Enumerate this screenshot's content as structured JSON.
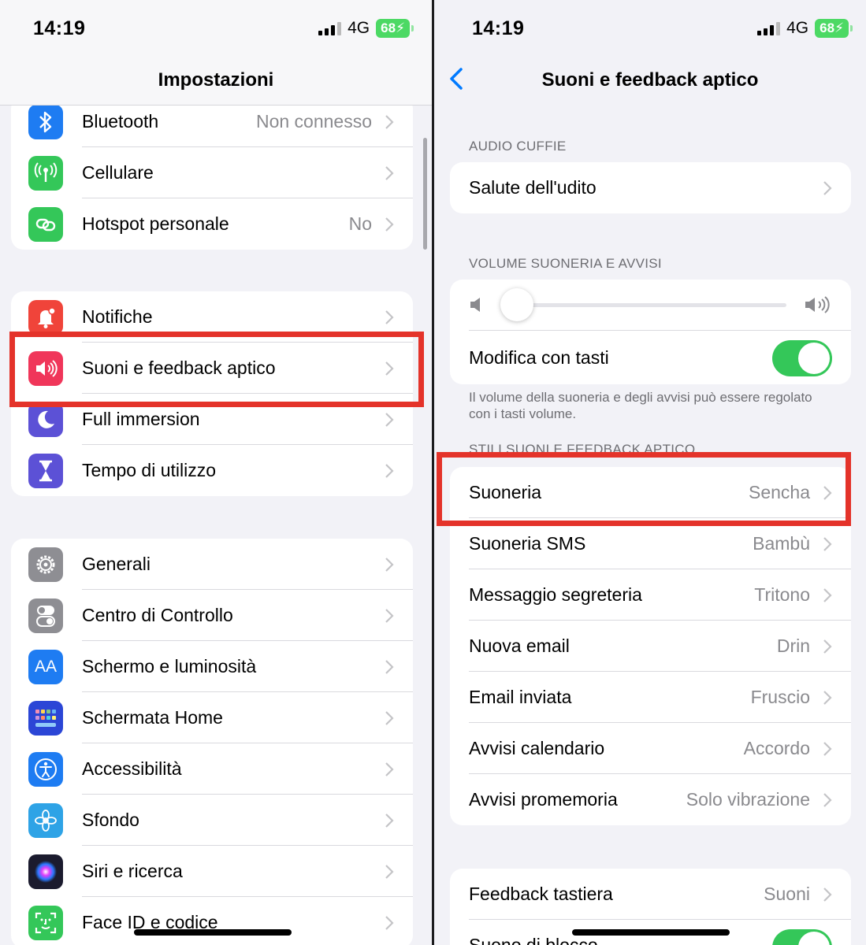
{
  "colors": {
    "highlight_box": "#e4332a",
    "ios_blue": "#007aff",
    "toggle_on": "#34c759",
    "battery_green": "#4cd964"
  },
  "left_screen": {
    "status": {
      "time": "14:19",
      "network": "4G",
      "battery": "68"
    },
    "title": "Impostazioni",
    "groups": [
      {
        "items": [
          {
            "label": "Bluetooth",
            "value": "Non connesso",
            "icon": "bluetooth-icon",
            "color": "#1e7cf2"
          },
          {
            "label": "Cellulare",
            "value": "",
            "icon": "antenna-icon",
            "color": "#34c759"
          },
          {
            "label": "Hotspot personale",
            "value": "No",
            "icon": "hotspot-icon",
            "color": "#34c759"
          }
        ]
      },
      {
        "items": [
          {
            "label": "Notifiche",
            "value": "",
            "icon": "bell-icon",
            "color": "#f0443a"
          },
          {
            "label": "Suoni e feedback aptico",
            "value": "",
            "icon": "speaker-icon",
            "color": "#f0365a"
          },
          {
            "label": "Full immersion",
            "value": "",
            "icon": "moon-icon",
            "color": "#5c51d6"
          },
          {
            "label": "Tempo di utilizzo",
            "value": "",
            "icon": "hourglass-icon",
            "color": "#5c51d6"
          }
        ]
      },
      {
        "items": [
          {
            "label": "Generali",
            "value": "",
            "icon": "gear-icon",
            "color": "#8e8e93"
          },
          {
            "label": "Centro di Controllo",
            "value": "",
            "icon": "switches-icon",
            "color": "#8e8e93"
          },
          {
            "label": "Schermo e luminosità",
            "value": "",
            "icon": "text-size-icon",
            "color": "#1e7cf2"
          },
          {
            "label": "Schermata Home",
            "value": "",
            "icon": "home-grid-icon",
            "color": "#2b46d6"
          },
          {
            "label": "Accessibilità",
            "value": "",
            "icon": "accessibility-icon",
            "color": "#1e7cf2"
          },
          {
            "label": "Sfondo",
            "value": "",
            "icon": "flower-icon",
            "color": "#2ea3e6"
          },
          {
            "label": "Siri e ricerca",
            "value": "",
            "icon": "siri-icon",
            "color": "#1b1b2e"
          },
          {
            "label": "Face ID e codice",
            "value": "",
            "icon": "face-id-icon",
            "color": "#34c759"
          }
        ]
      }
    ],
    "icon_text": {
      "text_size": "AA"
    }
  },
  "right_screen": {
    "status": {
      "time": "14:19",
      "network": "4G",
      "battery": "68"
    },
    "title": "Suoni e feedback aptico",
    "audio_section": {
      "header": "AUDIO CUFFIE",
      "items": [
        {
          "label": "Salute dell'udito"
        }
      ]
    },
    "volume_section": {
      "header": "VOLUME SUONERIA E AVVISI",
      "volume_level": 0.0,
      "toggle_label": "Modifica con tasti",
      "toggle_on": true,
      "footnote": "Il volume della suoneria e degli avvisi può essere regolato con i tasti volume."
    },
    "styles_section": {
      "header": "STILI SUONI E FEEDBACK APTICO",
      "items": [
        {
          "label": "Suoneria",
          "value": "Sencha"
        },
        {
          "label": "Suoneria SMS",
          "value": "Bambù"
        },
        {
          "label": "Messaggio segreteria",
          "value": "Tritono"
        },
        {
          "label": "Nuova email",
          "value": "Drin"
        },
        {
          "label": "Email inviata",
          "value": "Fruscio"
        },
        {
          "label": "Avvisi calendario",
          "value": "Accordo"
        },
        {
          "label": "Avvisi promemoria",
          "value": "Solo vibrazione"
        }
      ]
    },
    "keyboard_section": {
      "items": [
        {
          "label": "Feedback tastiera",
          "value": "Suoni"
        },
        {
          "label": "Suono di blocco",
          "value": ""
        }
      ]
    }
  }
}
